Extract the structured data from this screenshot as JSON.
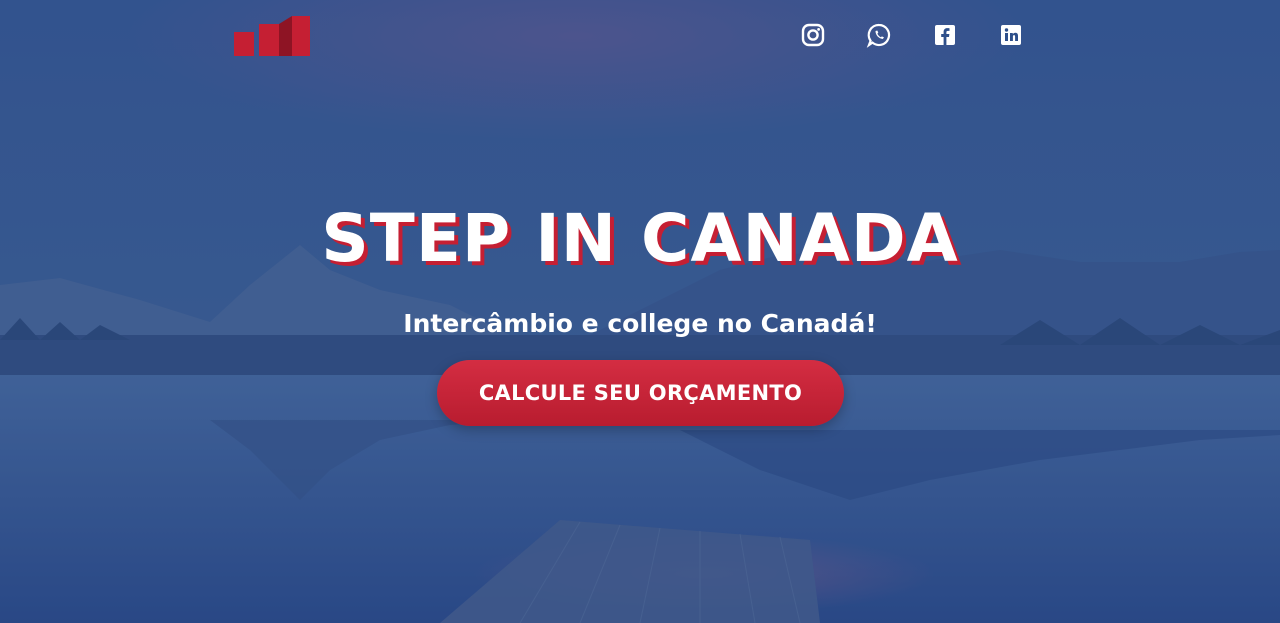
{
  "brand": {
    "accent": "#c51f33"
  },
  "header": {
    "logo_icon": "bar-logo-icon",
    "social": [
      {
        "name": "instagram-icon"
      },
      {
        "name": "whatsapp-icon"
      },
      {
        "name": "facebook-icon"
      },
      {
        "name": "linkedin-icon"
      }
    ]
  },
  "hero": {
    "title": "STEP IN CANADA",
    "subtitle": "Intercâmbio e college no Canadá!",
    "cta_label": "CALCULE SEU ORÇAMENTO"
  }
}
